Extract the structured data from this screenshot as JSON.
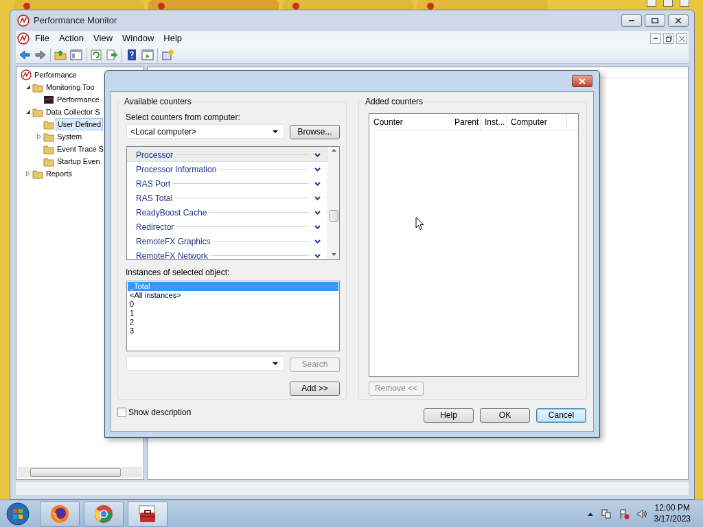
{
  "browser_tabs": [
    {
      "selected": false
    },
    {
      "selected": true
    },
    {
      "selected": false
    },
    {
      "selected": false
    }
  ],
  "window": {
    "title": "Performance Monitor"
  },
  "menu": [
    "File",
    "Action",
    "View",
    "Window",
    "Help"
  ],
  "tree": [
    {
      "label": "Performance",
      "selected": false,
      "children": [
        {
          "label": "Monitoring Too",
          "expanded": true,
          "selected": false,
          "children": [
            {
              "label": "Performance",
              "selected": false
            }
          ]
        },
        {
          "label": "Data Collector S",
          "expanded": true,
          "selected": false,
          "children": [
            {
              "label": "User Defined",
              "selected": true
            },
            {
              "label": "System",
              "expanded": false,
              "selected": false
            },
            {
              "label": "Event Trace S",
              "selected": false
            },
            {
              "label": "Startup Even",
              "selected": false
            }
          ]
        },
        {
          "label": "Reports",
          "expanded": false,
          "selected": false
        }
      ]
    }
  ],
  "dialog": {
    "available_counters": {
      "title": "Available counters",
      "computer_label": "Select counters from computer:",
      "computer_value": "<Local computer>",
      "browse_button": "Browse...",
      "objects": [
        {
          "name": "Processor",
          "selected": true
        },
        {
          "name": "Processor Information",
          "selected": false
        },
        {
          "name": "RAS Port",
          "selected": false
        },
        {
          "name": "RAS Total",
          "selected": false
        },
        {
          "name": "ReadyBoost Cache",
          "selected": false
        },
        {
          "name": "Redirector",
          "selected": false
        },
        {
          "name": "RemoteFX Graphics",
          "selected": false
        },
        {
          "name": "RemoteFX Network",
          "selected": false
        }
      ],
      "instances_label": "Instances of selected object:",
      "instances": [
        {
          "name": "_Total",
          "selected": true
        },
        {
          "name": "<All instances>",
          "selected": false
        },
        {
          "name": "0",
          "selected": false
        },
        {
          "name": "1",
          "selected": false
        },
        {
          "name": "2",
          "selected": false
        },
        {
          "name": "3",
          "selected": false
        }
      ],
      "search_button": {
        "label": "Search",
        "disabled": true
      },
      "add_button": "Add >>"
    },
    "added_counters": {
      "title": "Added counters",
      "columns": [
        "Counter",
        "Parent",
        "Inst...",
        "Computer"
      ],
      "remove_button": {
        "label": "Remove <<",
        "disabled": true
      }
    },
    "show_description": {
      "label": "Show description",
      "checked": false
    },
    "buttons": [
      {
        "label": "Help",
        "default": false
      },
      {
        "label": "OK",
        "default": false
      },
      {
        "label": "Cancel",
        "default": true
      }
    ]
  },
  "taskbar": {
    "time": "12:00 PM",
    "date": "3/17/2023"
  }
}
